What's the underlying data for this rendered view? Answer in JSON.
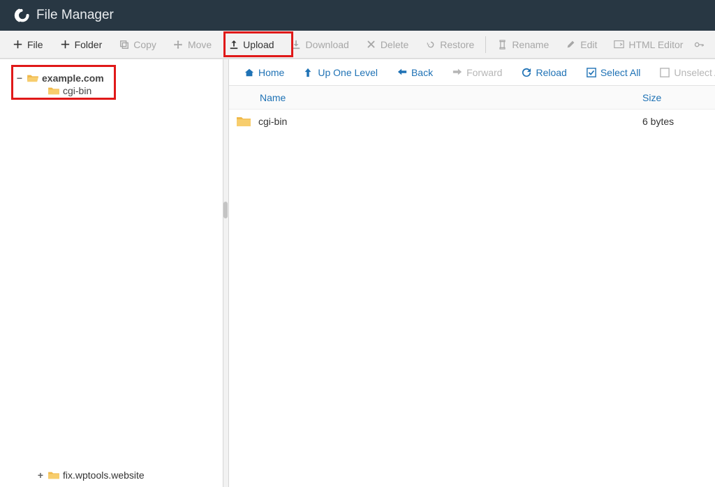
{
  "header": {
    "title": "File Manager"
  },
  "toolbar": {
    "file": "File",
    "folder": "Folder",
    "copy": "Copy",
    "move": "Move",
    "upload": "Upload",
    "download": "Download",
    "delete": "Delete",
    "restore": "Restore",
    "rename": "Rename",
    "edit": "Edit",
    "html_editor": "HTML Editor"
  },
  "nav": {
    "home": "Home",
    "up": "Up One Level",
    "back": "Back",
    "forward": "Forward",
    "reload": "Reload",
    "select_all": "Select All",
    "unselect_all": "Unselect All"
  },
  "tree": {
    "root": {
      "label": "example.com",
      "expander": "−"
    },
    "child": {
      "label": "cgi-bin"
    },
    "bottom": {
      "label": "fix.wptools.website",
      "expander": "+"
    }
  },
  "grid": {
    "columns": {
      "name": "Name",
      "size": "Size"
    },
    "rows": [
      {
        "name": "cgi-bin",
        "size": "6 bytes"
      }
    ]
  }
}
